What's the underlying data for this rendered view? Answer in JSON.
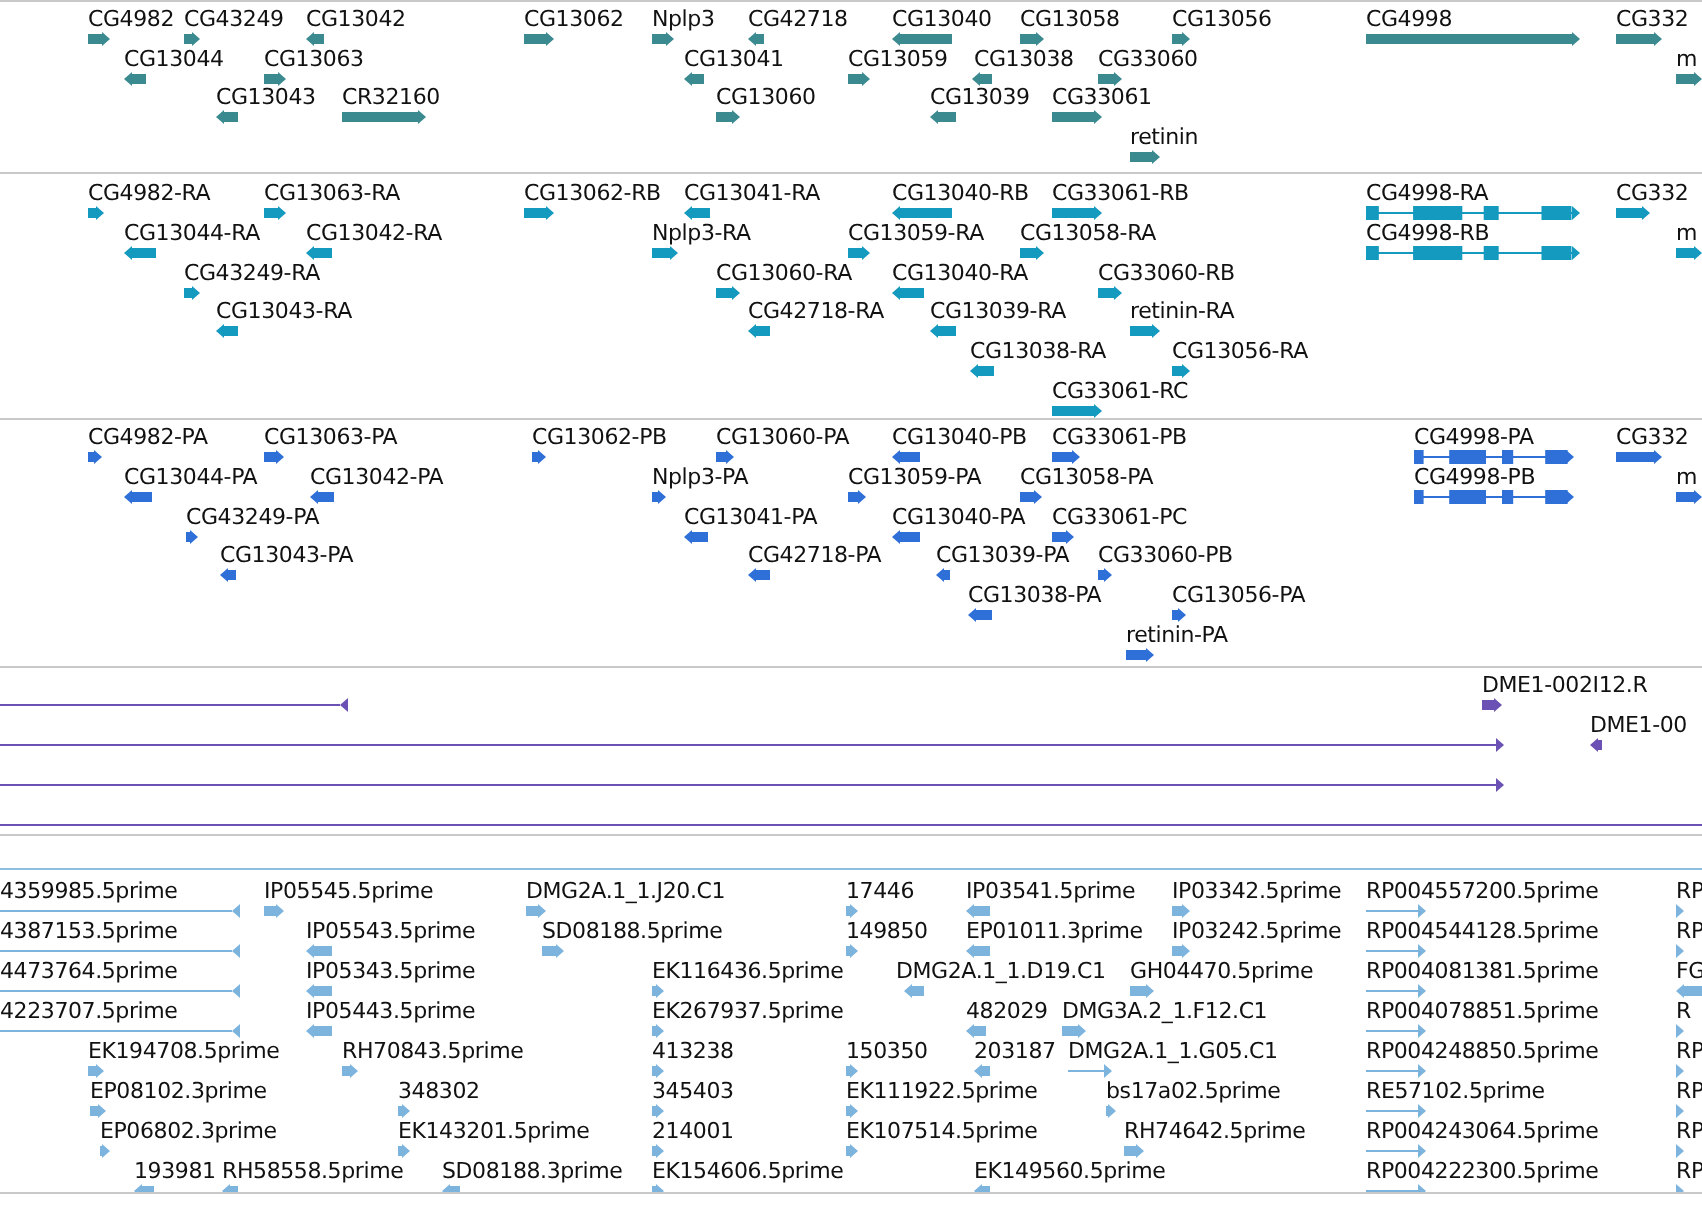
{
  "tracks": [
    {
      "color": "#3a8a8f",
      "features": [
        {
          "label": "CG4982",
          "reverse": false
        },
        {
          "label": "CG43249",
          "reverse": false
        },
        {
          "label": "CG13042",
          "reverse": true
        },
        {
          "label": "CG13062",
          "reverse": false
        },
        {
          "label": "Nplp3",
          "reverse": false
        },
        {
          "label": "CG42718",
          "reverse": true
        },
        {
          "label": "CG13040",
          "reverse": true
        },
        {
          "label": "CG13058",
          "reverse": false
        },
        {
          "label": "CG13056",
          "reverse": false
        },
        {
          "label": "CG4998",
          "reverse": false
        },
        {
          "label": "CG332",
          "reverse": false
        },
        {
          "label": "CG13044",
          "reverse": true
        },
        {
          "label": "CG13063",
          "reverse": false
        },
        {
          "label": "CG13041",
          "reverse": true
        },
        {
          "label": "CG13059",
          "reverse": false
        },
        {
          "label": "CG13038",
          "reverse": true
        },
        {
          "label": "CG33060",
          "reverse": false
        },
        {
          "label": "m",
          "reverse": false
        },
        {
          "label": "CG13043",
          "reverse": true
        },
        {
          "label": "CR32160",
          "reverse": false
        },
        {
          "label": "CG13060",
          "reverse": false
        },
        {
          "label": "CG13039",
          "reverse": true
        },
        {
          "label": "CG33061",
          "reverse": false
        },
        {
          "label": "retinin",
          "reverse": false
        }
      ]
    },
    {
      "color": "#1499bf",
      "features": [
        {
          "label": "CG4982-RA",
          "reverse": false
        },
        {
          "label": "CG13063-RA",
          "reverse": false
        },
        {
          "label": "CG13062-RB",
          "reverse": false
        },
        {
          "label": "CG13041-RA",
          "reverse": true
        },
        {
          "label": "CG13040-RB",
          "reverse": true
        },
        {
          "label": "CG33061-RB",
          "reverse": false
        },
        {
          "label": "CG4998-RA",
          "reverse": false
        },
        {
          "label": "CG332",
          "reverse": false
        },
        {
          "label": "CG13044-RA",
          "reverse": true
        },
        {
          "label": "CG13042-RA",
          "reverse": true
        },
        {
          "label": "Nplp3-RA",
          "reverse": false
        },
        {
          "label": "CG13059-RA",
          "reverse": false
        },
        {
          "label": "CG13058-RA",
          "reverse": false
        },
        {
          "label": "CG4998-RB",
          "reverse": false
        },
        {
          "label": "m",
          "reverse": false
        },
        {
          "label": "CG43249-RA",
          "reverse": false
        },
        {
          "label": "CG13060-RA",
          "reverse": false
        },
        {
          "label": "CG13040-RA",
          "reverse": true
        },
        {
          "label": "CG33060-RB",
          "reverse": false
        },
        {
          "label": "CG13043-RA",
          "reverse": true
        },
        {
          "label": "CG42718-RA",
          "reverse": true
        },
        {
          "label": "CG13039-RA",
          "reverse": true
        },
        {
          "label": "retinin-RA",
          "reverse": false
        },
        {
          "label": "CG13038-RA",
          "reverse": true
        },
        {
          "label": "CG13056-RA",
          "reverse": false
        },
        {
          "label": "CG33061-RC",
          "reverse": false
        }
      ]
    },
    {
      "color": "#2e6fd8",
      "features": [
        {
          "label": "CG4982-PA",
          "reverse": false
        },
        {
          "label": "CG13063-PA",
          "reverse": false
        },
        {
          "label": "CG13062-PB",
          "reverse": false
        },
        {
          "label": "CG13060-PA",
          "reverse": false
        },
        {
          "label": "CG13040-PB",
          "reverse": true
        },
        {
          "label": "CG33061-PB",
          "reverse": false
        },
        {
          "label": "CG4998-PA",
          "reverse": false
        },
        {
          "label": "CG332",
          "reverse": false
        },
        {
          "label": "CG13044-PA",
          "reverse": true
        },
        {
          "label": "CG13042-PA",
          "reverse": true
        },
        {
          "label": "Nplp3-PA",
          "reverse": false
        },
        {
          "label": "CG13059-PA",
          "reverse": false
        },
        {
          "label": "CG13058-PA",
          "reverse": false
        },
        {
          "label": "CG4998-PB",
          "reverse": false
        },
        {
          "label": "m",
          "reverse": false
        },
        {
          "label": "CG43249-PA",
          "reverse": false
        },
        {
          "label": "CG13041-PA",
          "reverse": true
        },
        {
          "label": "CG13040-PA",
          "reverse": true
        },
        {
          "label": "CG33061-PC",
          "reverse": false
        },
        {
          "label": "CG13043-PA",
          "reverse": true
        },
        {
          "label": "CG42718-PA",
          "reverse": true
        },
        {
          "label": "CG13039-PA",
          "reverse": true
        },
        {
          "label": "CG33060-PB",
          "reverse": false
        },
        {
          "label": "CG13038-PA",
          "reverse": true
        },
        {
          "label": "CG13056-PA",
          "reverse": false
        },
        {
          "label": "retinin-PA",
          "reverse": false
        }
      ]
    },
    {
      "color": "#6b51b3",
      "features": [
        {
          "reverse": true
        },
        {
          "label": "DME1-002I12.R",
          "reverse": false
        },
        {
          "reverse": false
        },
        {
          "label": "DME1-00",
          "reverse": true
        },
        {
          "reverse": false
        },
        {
          "reverse": false
        }
      ]
    },
    {
      "color": "#7db4de",
      "features": [
        {
          "label": "4359985.5prime",
          "reverse": true
        },
        {
          "label": "IP05545.5prime",
          "reverse": false
        },
        {
          "label": "DMG2A.1_1.J20.C1",
          "reverse": false
        },
        {
          "label": "17446",
          "reverse": false
        },
        {
          "label": "IP03541.5prime",
          "reverse": true
        },
        {
          "label": "IP03342.5prime",
          "reverse": false
        },
        {
          "label": "RP004557200.5prime",
          "reverse": false
        },
        {
          "label": "RP",
          "reverse": false
        },
        {
          "label": "4387153.5prime",
          "reverse": true
        },
        {
          "label": "IP05543.5prime",
          "reverse": true
        },
        {
          "label": "SD08188.5prime",
          "reverse": false
        },
        {
          "label": "149850",
          "reverse": false
        },
        {
          "label": "EP01011.3prime",
          "reverse": true
        },
        {
          "label": "IP03242.5prime",
          "reverse": false
        },
        {
          "label": "RP004544128.5prime",
          "reverse": false
        },
        {
          "label": "RP",
          "reverse": false
        },
        {
          "label": "4473764.5prime",
          "reverse": true
        },
        {
          "label": "IP05343.5prime",
          "reverse": true
        },
        {
          "label": "EK116436.5prime",
          "reverse": false
        },
        {
          "label": "DMG2A.1_1.D19.C1",
          "reverse": true
        },
        {
          "label": "GH04470.5prime",
          "reverse": false
        },
        {
          "label": "RP004081381.5prime",
          "reverse": false
        },
        {
          "label": "FG",
          "reverse": true
        },
        {
          "label": "4223707.5prime",
          "reverse": true
        },
        {
          "label": "IP05443.5prime",
          "reverse": true
        },
        {
          "label": "EK267937.5prime",
          "reverse": false
        },
        {
          "label": "482029",
          "reverse": true
        },
        {
          "label": "DMG3A.2_1.F12.C1",
          "reverse": false
        },
        {
          "label": "RP004078851.5prime",
          "reverse": false
        },
        {
          "label": "R",
          "reverse": false
        },
        {
          "label": "EK194708.5prime",
          "reverse": false
        },
        {
          "label": "RH70843.5prime",
          "reverse": false
        },
        {
          "label": "413238",
          "reverse": false
        },
        {
          "label": "150350",
          "reverse": false
        },
        {
          "label": "203187",
          "reverse": true
        },
        {
          "label": "DMG2A.1_1.G05.C1",
          "reverse": false
        },
        {
          "label": "RP004248850.5prime",
          "reverse": false
        },
        {
          "label": "RP",
          "reverse": false
        },
        {
          "label": "EP08102.3prime",
          "reverse": false
        },
        {
          "label": "348302",
          "reverse": false
        },
        {
          "label": "345403",
          "reverse": false
        },
        {
          "label": "EK111922.5prime",
          "reverse": false
        },
        {
          "label": "bs17a02.5prime",
          "reverse": false
        },
        {
          "label": "RE57102.5prime",
          "reverse": false
        },
        {
          "label": "RP",
          "reverse": false
        },
        {
          "label": "EP06802.3prime",
          "reverse": false
        },
        {
          "label": "EK143201.5prime",
          "reverse": false
        },
        {
          "label": "214001",
          "reverse": false
        },
        {
          "label": "EK107514.5prime",
          "reverse": false
        },
        {
          "label": "RH74642.5prime",
          "reverse": false
        },
        {
          "label": "RP004243064.5prime",
          "reverse": false
        },
        {
          "label": "RP",
          "reverse": false
        },
        {
          "label": "193981",
          "reverse": true
        },
        {
          "label": "RH58558.5prime",
          "reverse": true
        },
        {
          "label": "SD08188.3prime",
          "reverse": true
        },
        {
          "label": "EK154606.5prime",
          "reverse": false
        },
        {
          "label": "EK149560.5prime",
          "reverse": true
        },
        {
          "label": "RP004222300.5prime",
          "reverse": false
        },
        {
          "label": "RP",
          "reverse": false
        }
      ]
    }
  ]
}
